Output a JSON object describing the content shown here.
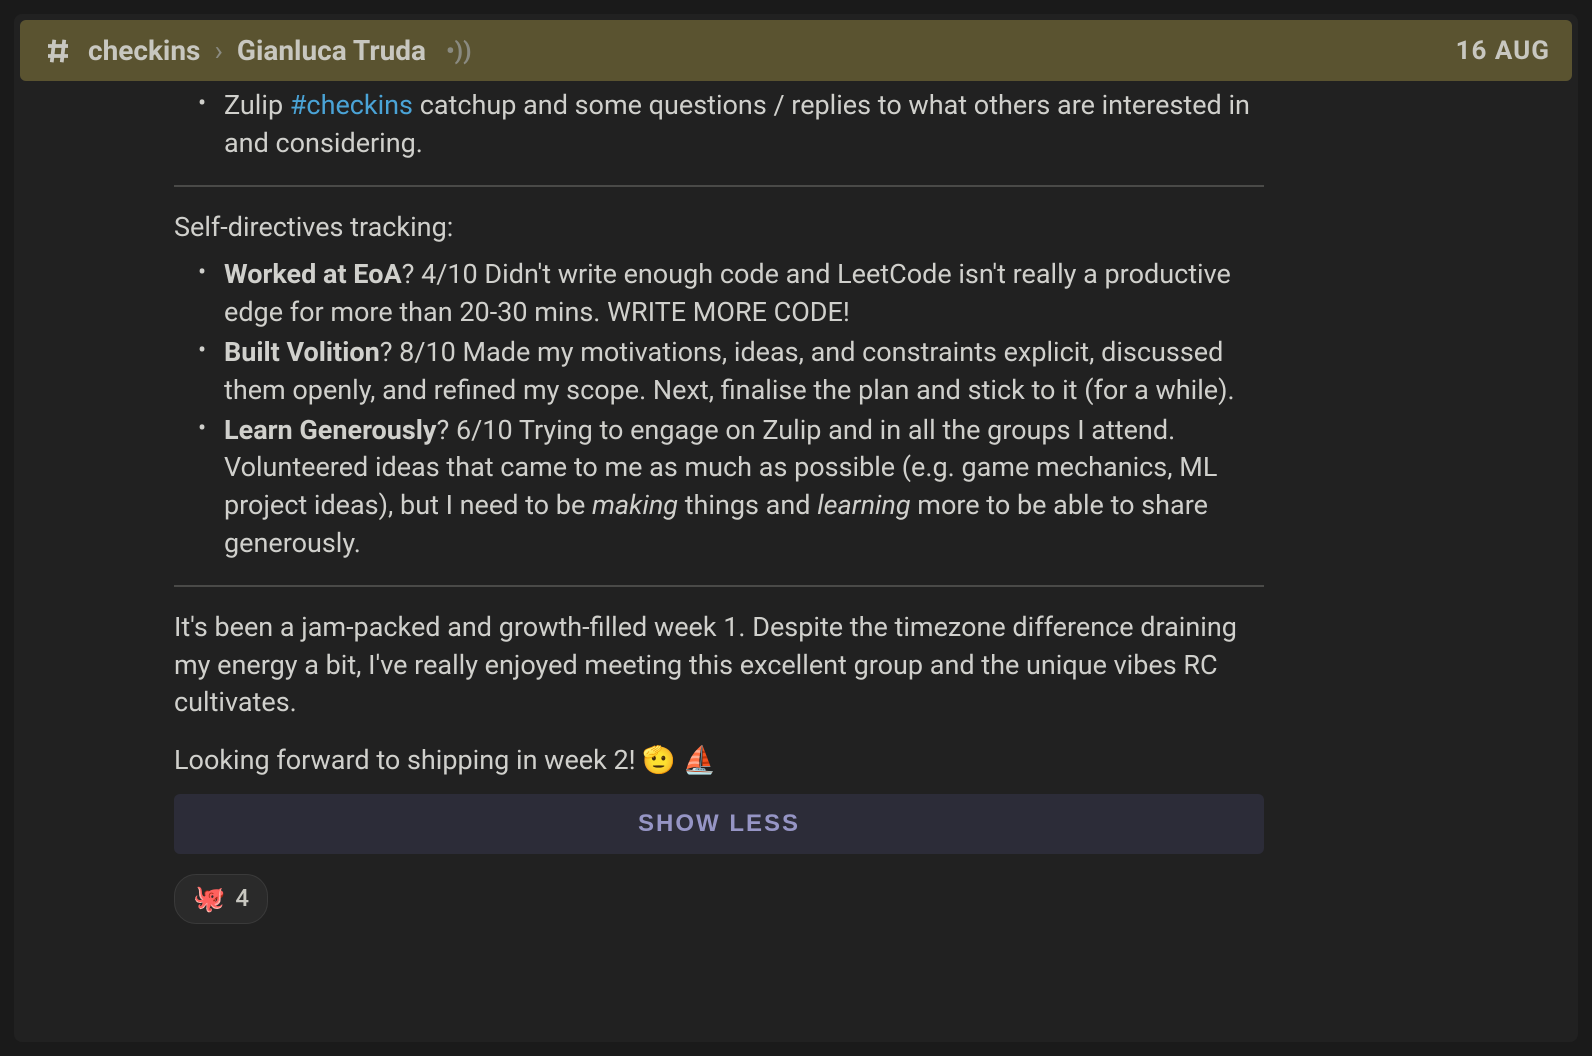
{
  "header": {
    "channel": "checkins",
    "topic": "Gianluca Truda",
    "date": "16 AUG"
  },
  "message": {
    "partial_item_prefix": "Zulip ",
    "partial_link": "#checkins",
    "partial_item_suffix": " catchup and some questions / replies to what others are interested in and considering.",
    "section_title": "Self-directives tracking:",
    "directives": [
      {
        "label": "Worked at EoA",
        "text": "? 4/10 Didn't write enough code and LeetCode isn't really a productive edge for more than 20-30 mins. WRITE MORE CODE!"
      },
      {
        "label": "Built Volition",
        "text": "? 8/10 Made my motivations, ideas, and constraints explicit, discussed them openly, and refined my scope. Next, finalise the plan and stick to it (for a while)."
      },
      {
        "label": "Learn Generously",
        "text_before": "? 6/10 Trying to engage on Zulip and in all the groups I attend. Volunteered ideas that came to me as much as possible (e.g. game mechanics, ML project ideas), but I need to be ",
        "em1": "making",
        "text_mid": " things and ",
        "em2": "learning",
        "text_after": " more to be able to share generously."
      }
    ],
    "closing": "It's been a jam-packed and growth-filled week 1. Despite the timezone difference draining my energy a bit, I've really enjoyed meeting this excellent group and the unique vibes RC cultivates.",
    "final_line": "Looking forward to shipping in week 2! 🫡 ⛵"
  },
  "show_less_label": "SHOW LESS",
  "reaction": {
    "emoji": "🐙",
    "count": "4"
  }
}
